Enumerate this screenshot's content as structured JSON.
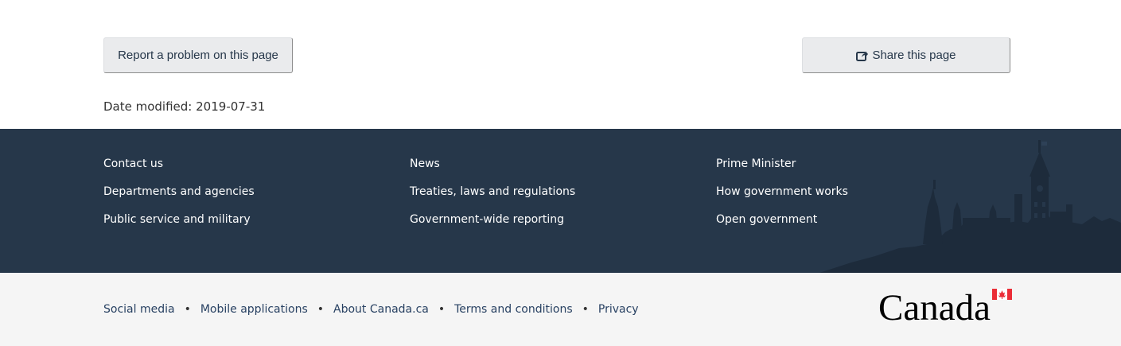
{
  "actions": {
    "report_label": "Report a problem on this page",
    "share_label": "Share this page"
  },
  "date_modified": {
    "label": "Date modified:",
    "value": "2019-07-31"
  },
  "main_footer": {
    "columns": [
      [
        "Contact us",
        "Departments and agencies",
        "Public service and military"
      ],
      [
        "News",
        "Treaties, laws and regulations",
        "Government-wide reporting"
      ],
      [
        "Prime Minister",
        "How government works",
        "Open government"
      ]
    ]
  },
  "sub_footer": {
    "links": [
      "Social media",
      "Mobile applications",
      "About Canada.ca",
      "Terms and conditions",
      "Privacy"
    ],
    "separator": "•"
  },
  "wordmark": {
    "text": "Canada"
  },
  "colors": {
    "footer_bg": "#26374a",
    "subfooter_bg": "#f5f5f5",
    "button_bg": "#eaebed",
    "link_color": "#284162",
    "flag_red": "#eb2d37"
  },
  "icons": [
    "share-icon",
    "parliament-skyline-icon",
    "canada-wordmark-logo"
  ]
}
